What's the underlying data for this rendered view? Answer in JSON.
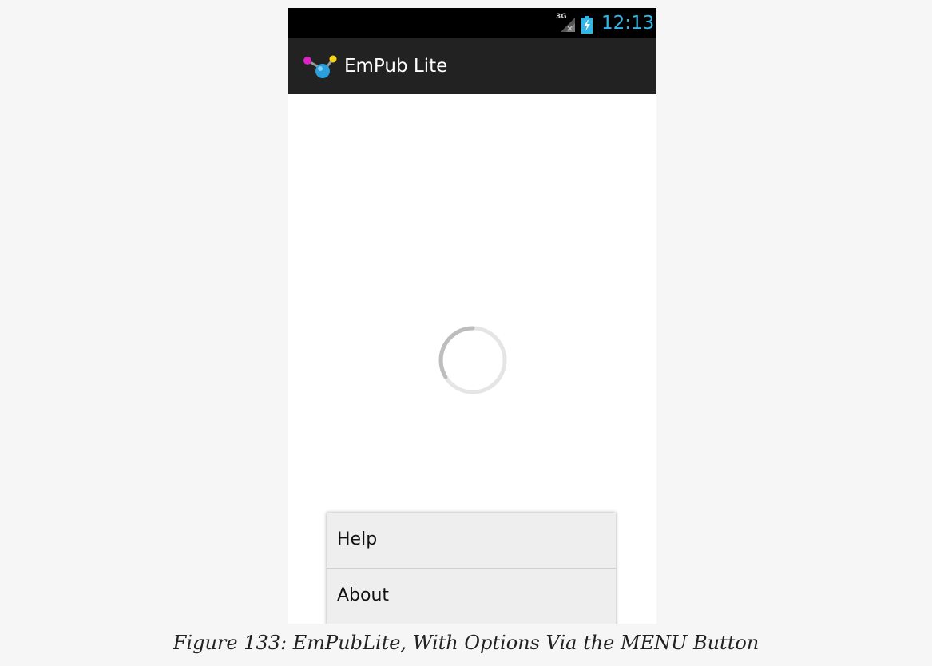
{
  "status_bar": {
    "network_label": "3G",
    "time": "12:13",
    "signal_icon": "signal-icon",
    "battery_icon": "battery-charging-icon"
  },
  "action_bar": {
    "app_icon": "empub-logo-icon",
    "title": "EmPub Lite"
  },
  "content": {
    "spinner_icon": "loading-spinner-icon"
  },
  "options_menu": {
    "items": [
      {
        "label": "Help"
      },
      {
        "label": "About"
      }
    ]
  },
  "caption": "Figure 133: EmPubLite, With Options Via the MENU Button",
  "colors": {
    "accent": "#33b5e5",
    "action_bar_bg": "#222222",
    "status_bar_bg": "#000000",
    "menu_bg": "#eeeeee"
  }
}
